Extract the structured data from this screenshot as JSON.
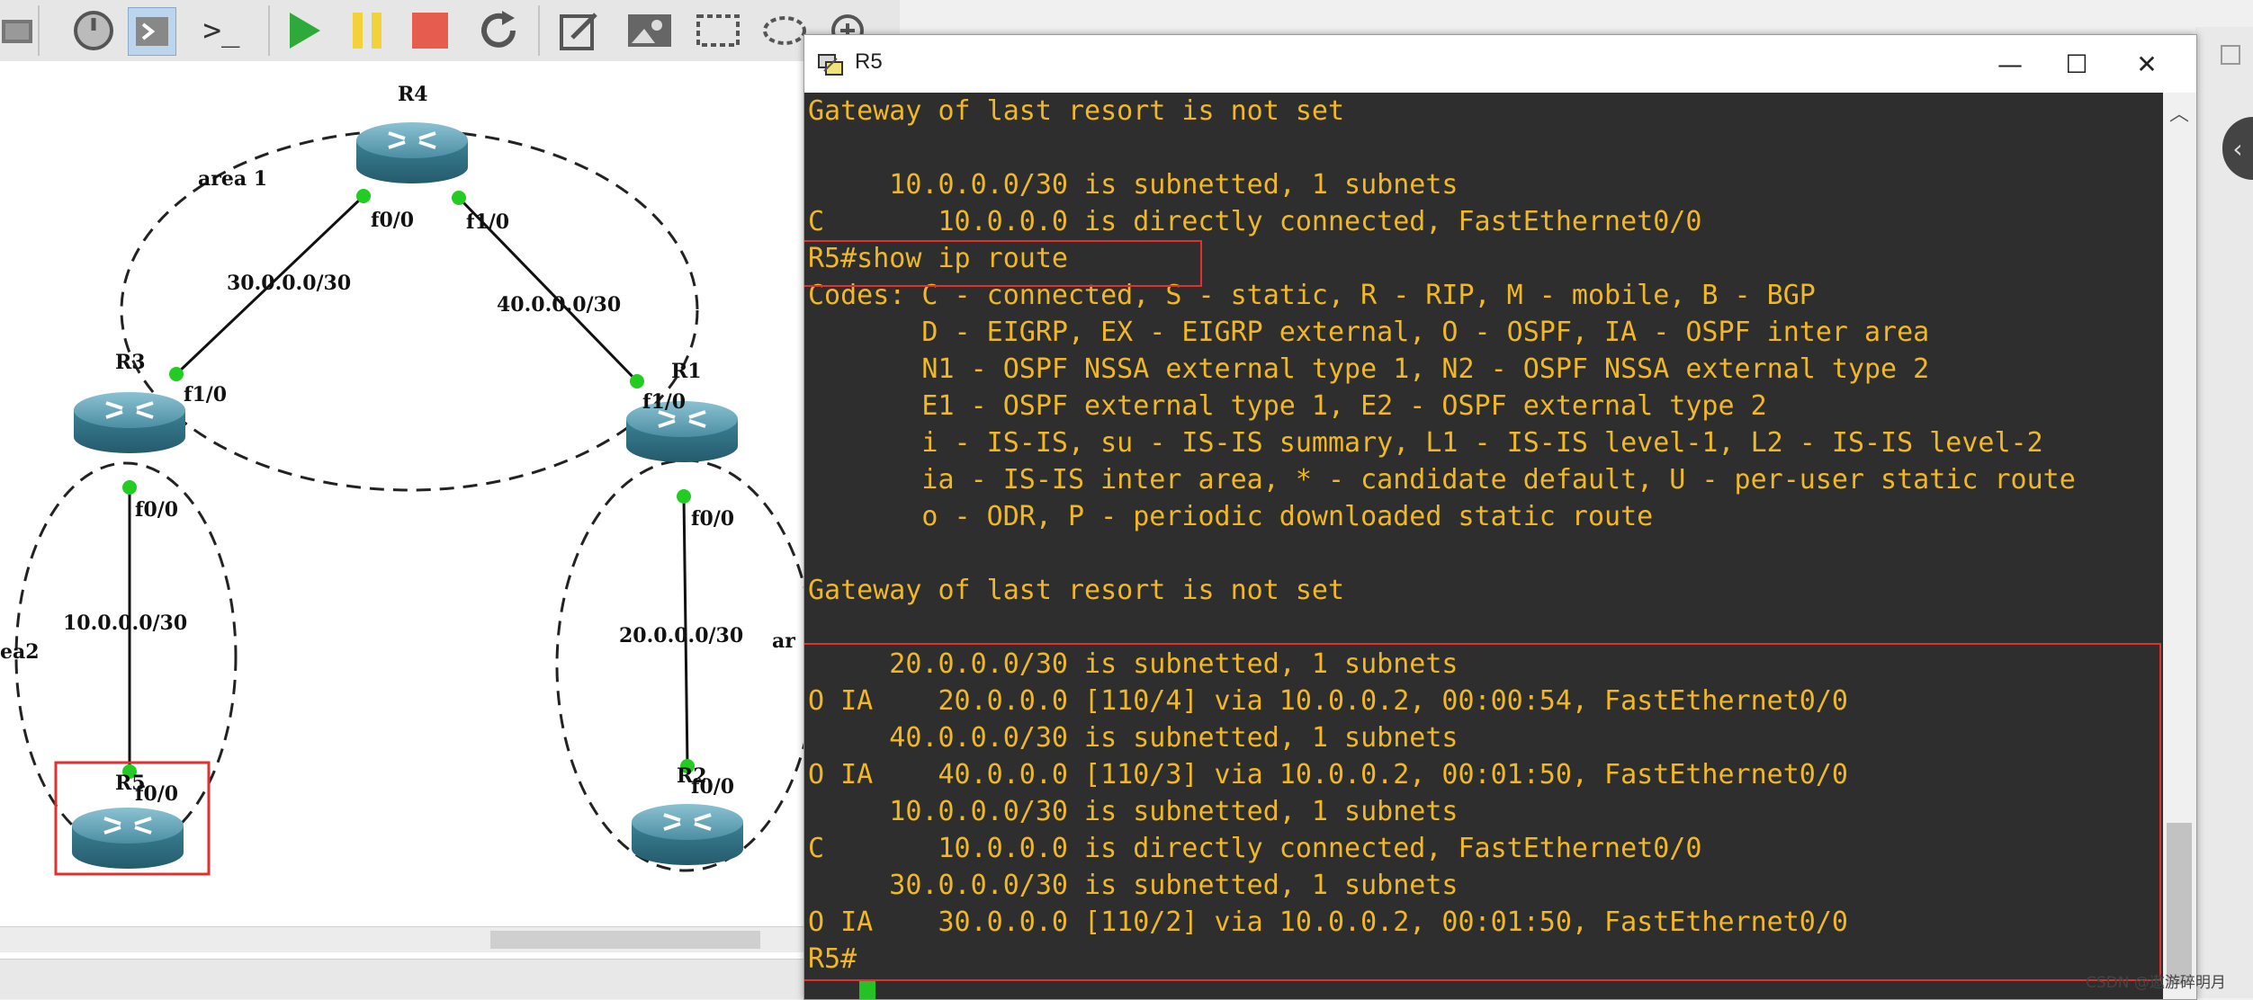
{
  "toolbar": {
    "buttons": [
      {
        "icon": "device-icon"
      },
      {
        "icon": "clock-icon"
      },
      {
        "icon": "console-all-icon"
      },
      {
        "icon": "terminal-icon",
        "label": ">_"
      },
      {
        "icon": "play-icon"
      },
      {
        "icon": "pause-icon"
      },
      {
        "icon": "stop-icon"
      },
      {
        "icon": "reload-icon"
      },
      {
        "icon": "edit-note-icon"
      },
      {
        "icon": "insert-picture-icon"
      },
      {
        "icon": "draw-rectangle-icon"
      },
      {
        "icon": "draw-ellipse-icon"
      },
      {
        "icon": "zoom-in-icon"
      },
      {
        "icon": "zoom-out-icon"
      },
      {
        "icon": "screenshot-icon"
      }
    ]
  },
  "topology": {
    "routers": {
      "R4": "R4",
      "R3": "R3",
      "R1": "R1",
      "R5": "R5",
      "R2": "R2"
    },
    "areas": {
      "area1": "area 1",
      "area2": "ea2",
      "area_right": "ar"
    },
    "interfaces": {
      "r4_f00": "f0/0",
      "r4_f10": "f1/0",
      "r3_f10": "f1/0",
      "r1_f10": "f1/0",
      "r3_f00": "f0/0",
      "r1_f00": "f0/0",
      "r5_f00": "f0/0",
      "r2_f00": "f0/0"
    },
    "links": {
      "r4_r3": "30.0.0.0/30",
      "r4_r1": "40.0.0.0/30",
      "r3_r5": "10.0.0.0/30",
      "r1_r2": "20.0.0.0/30"
    },
    "colors": {
      "router_top": "#5e9fb2",
      "router_side": "#2f6f84",
      "link_dot": "#22cc22",
      "highlight": "#e03030"
    }
  },
  "terminal": {
    "title": "R5",
    "controls": {
      "minimize": "—",
      "maximize": "☐",
      "close": "✕"
    },
    "lines": [
      "Gateway of last resort is not set",
      "",
      "     10.0.0.0/30 is subnetted, 1 subnets",
      "C       10.0.0.0 is directly connected, FastEthernet0/0",
      "R5#show ip route",
      "Codes: C - connected, S - static, R - RIP, M - mobile, B - BGP",
      "       D - EIGRP, EX - EIGRP external, O - OSPF, IA - OSPF inter area",
      "       N1 - OSPF NSSA external type 1, N2 - OSPF NSSA external type 2",
      "       E1 - OSPF external type 1, E2 - OSPF external type 2",
      "       i - IS-IS, su - IS-IS summary, L1 - IS-IS level-1, L2 - IS-IS level-2",
      "       ia - IS-IS inter area, * - candidate default, U - per-user static route",
      "       o - ODR, P - periodic downloaded static route",
      "",
      "Gateway of last resort is not set",
      "",
      "     20.0.0.0/30 is subnetted, 1 subnets",
      "O IA    20.0.0.0 [110/4] via 10.0.0.2, 00:00:54, FastEthernet0/0",
      "     40.0.0.0/30 is subnetted, 1 subnets",
      "O IA    40.0.0.0 [110/3] via 10.0.0.2, 00:01:50, FastEthernet0/0",
      "     10.0.0.0/30 is subnetted, 1 subnets",
      "C       10.0.0.0 is directly connected, FastEthernet0/0",
      "     30.0.0.0/30 is subnetted, 1 subnets",
      "O IA    30.0.0.0 [110/2] via 10.0.0.2, 00:01:50, FastEthernet0/0",
      "R5#"
    ],
    "colors": {
      "background": "#2e2e2e",
      "text": "#f0b826",
      "cursor": "#22c322"
    }
  },
  "side_panel": {
    "collapse_label": "‹"
  },
  "watermark": "CSDN @遨游碎明月"
}
